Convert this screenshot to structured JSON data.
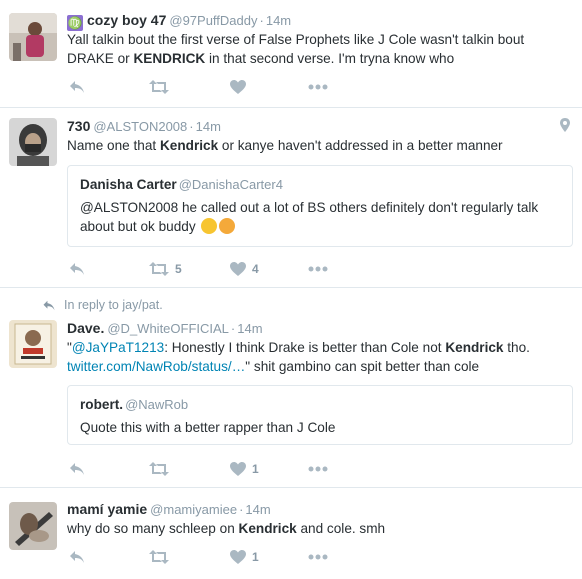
{
  "tweets": [
    {
      "fullname": "cozy boy 47",
      "handle": "@97PuffDaddy",
      "time": "14m",
      "zodiac": "♍",
      "text_parts": [
        "Yall talkin bout the first verse of False Prophets like J Cole wasn't talkin bout DRAKE or ",
        "KENDRICK",
        " in that second verse. I'm tryna know who"
      ],
      "avatar_color": "#b23a63"
    },
    {
      "fullname": "730",
      "handle": "@ALSTON2008",
      "time": "14m",
      "text_parts": [
        "Name one that ",
        "Kendrick",
        " or kanye haven't addressed in a better manner"
      ],
      "retweet_count": "5",
      "like_count": "4",
      "avatar_color": "#8e8e8e",
      "quote": {
        "fullname": "Danisha Carter",
        "handle": "@DanishaCarter4",
        "text": "@ALSTON2008 he called out a lot of BS others definitely don't regularly talk about but ok buddy"
      }
    },
    {
      "reply_to": "In reply to jay/pat.",
      "fullname": "Dave.",
      "handle": "@D_WhiteOFFICIAL",
      "time": "14m",
      "text_quote_open": "\"",
      "text_mention": "@JaYPaT1213",
      "text_mid": ": Honestly I think Drake is better than Cole not ",
      "text_bold": "Kendrick",
      "text_end": " tho.",
      "text_link": "twitter.com/NawRob/status/…",
      "text_tail": "\" shit gambino can spit better than cole",
      "like_count": "1",
      "avatar_color": "#d9c9a8",
      "quote": {
        "fullname": "robert.",
        "handle": "@NawRob",
        "text": "Quote this with a better rapper than J Cole"
      }
    },
    {
      "fullname": "mamí yamie",
      "handle": "@mamiyamiee",
      "time": "14m",
      "text_parts": [
        "why do so many schleep on ",
        "Kendrick",
        " and cole. smh"
      ],
      "like_count": "1",
      "avatar_color": "#9a8a7a"
    }
  ],
  "separator": "·",
  "colors": {
    "icon": "#aab8c2",
    "link": "#0084b4",
    "muted": "#8899a6"
  }
}
